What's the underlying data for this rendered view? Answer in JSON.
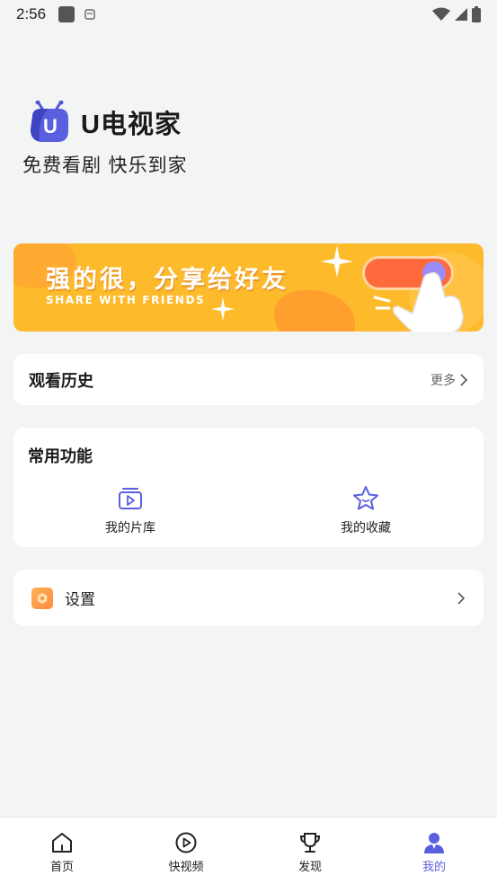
{
  "status_bar": {
    "time": "2:56"
  },
  "brand": {
    "name": "U电视家",
    "slogan": "免费看剧 快乐到家",
    "logo_letter": "U"
  },
  "banner": {
    "title": "强的很，分享给好友",
    "subtitle": "SHARE WITH FRIENDS"
  },
  "history": {
    "label": "观看历史",
    "more_label": "更多"
  },
  "functions": {
    "label": "常用功能",
    "items": [
      {
        "label": "我的片库",
        "icon": "library-icon"
      },
      {
        "label": "我的收藏",
        "icon": "star-icon"
      }
    ]
  },
  "settings": {
    "label": "设置"
  },
  "tabbar": {
    "items": [
      {
        "label": "首页",
        "icon": "home-icon"
      },
      {
        "label": "快视频",
        "icon": "play-icon"
      },
      {
        "label": "发现",
        "icon": "trophy-icon"
      },
      {
        "label": "我的",
        "icon": "profile-icon",
        "active": true
      }
    ]
  },
  "colors": {
    "accent": "#5a5fe0",
    "banner_bg": "#fdbb2c",
    "page_bg": "#f2f5f4"
  }
}
